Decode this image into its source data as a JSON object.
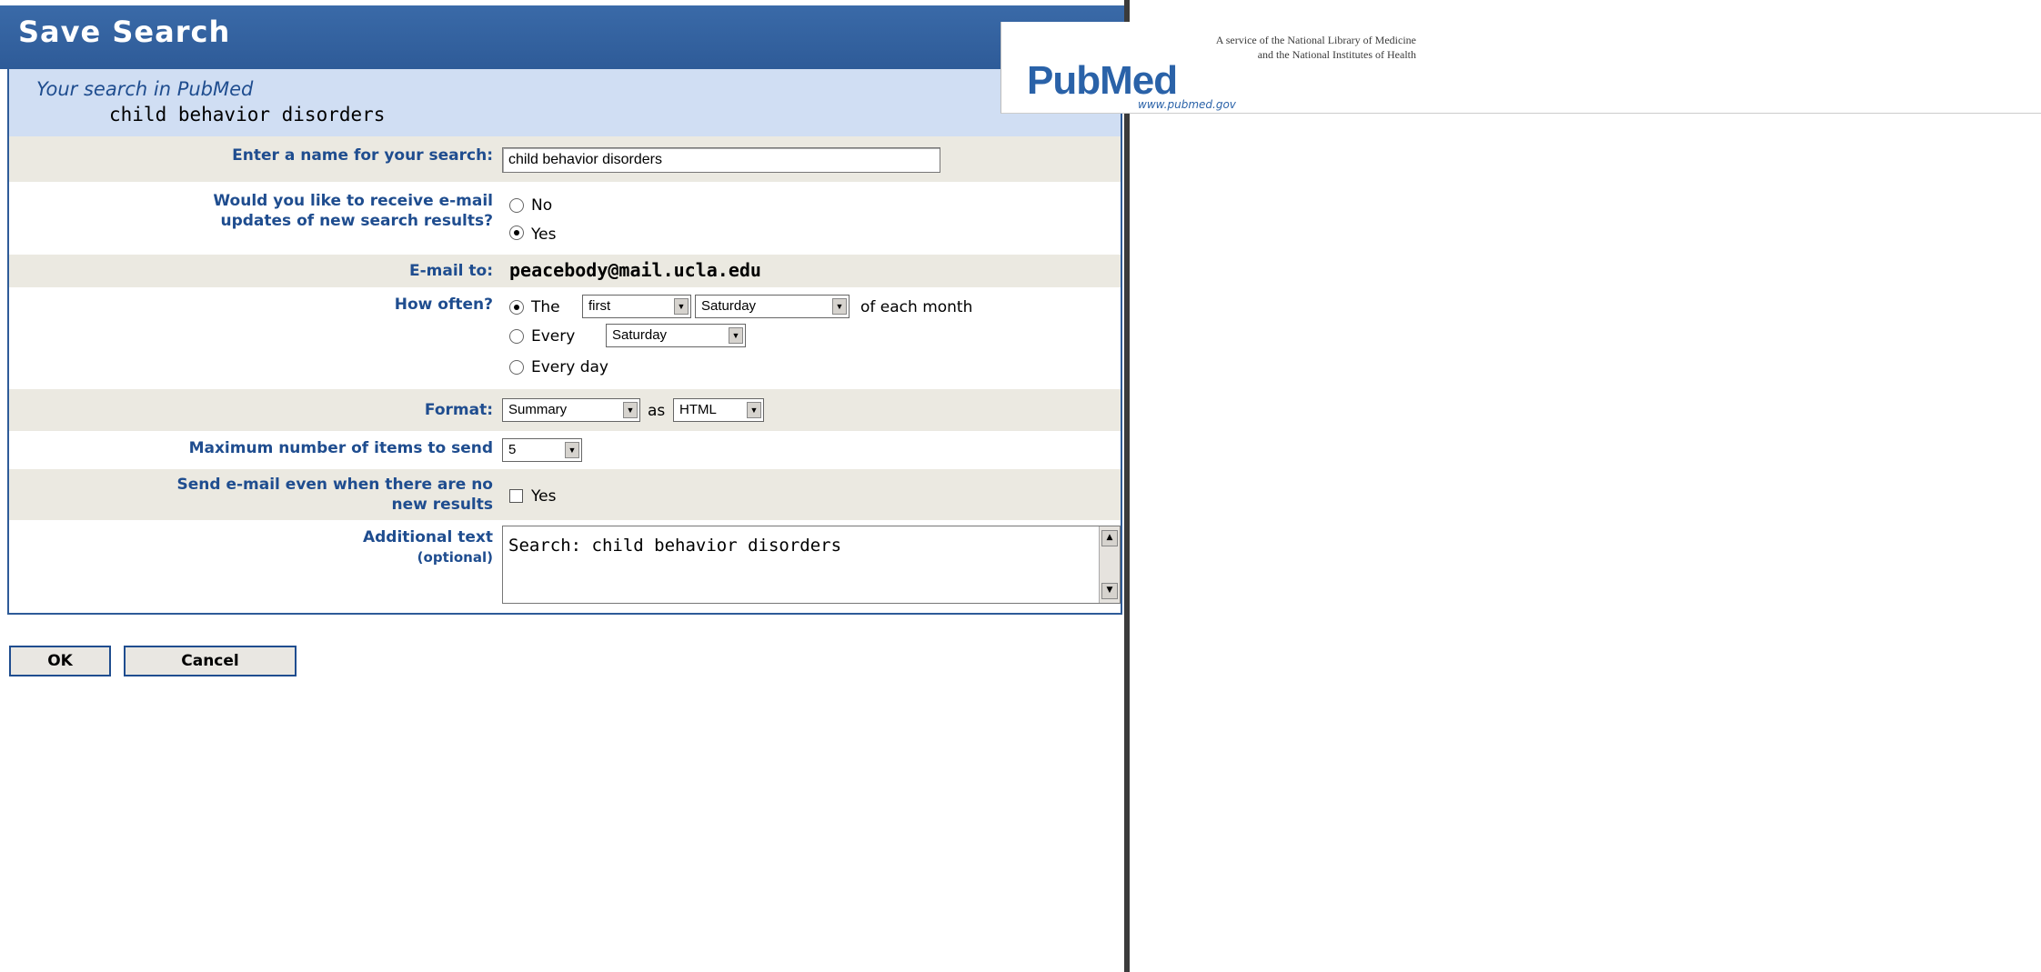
{
  "window": {
    "title": "Save Search"
  },
  "intro": {
    "label": "Your search in PubMed",
    "query": "child behavior disorders"
  },
  "name_row": {
    "label": "Enter a name for your search:",
    "value": "child behavior disorders"
  },
  "updates_row": {
    "label_line1": "Would you like to receive e-mail",
    "label_line2": "updates of new search results?",
    "options": [
      "No",
      "Yes"
    ],
    "selected": "Yes"
  },
  "email_row": {
    "label": "E-mail to:",
    "value": "peacebody@mail.ucla.edu"
  },
  "frequency_row": {
    "label": "How often?",
    "opt_the_label": "The",
    "ordinal_value": "first",
    "weekday_value": "Saturday",
    "suffix": "of each month",
    "opt_every_label": "Every",
    "every_weekday_value": "Saturday",
    "opt_daily_label": "Every day",
    "selected": "The"
  },
  "format_row": {
    "label": "Format:",
    "format_value": "Summary",
    "as_label": "as",
    "output_value": "HTML"
  },
  "max_row": {
    "label": "Maximum number of items to send",
    "value": "5"
  },
  "empty_row": {
    "label_line1": "Send e-mail even when there are no",
    "label_line2": "new results",
    "checkbox_label": "Yes",
    "checked": false
  },
  "additional_row": {
    "label_line1": "Additional text",
    "label_line2": "(optional)",
    "value": "Search: child behavior disorders"
  },
  "buttons": {
    "ok": "OK",
    "cancel": "Cancel"
  },
  "logo": {
    "brand_pub": "Pub",
    "brand_med": "Med",
    "url": "www.pubmed.gov",
    "service_line1": "A service of the National Library of Medicine",
    "service_line2": "and the National Institutes of Health"
  }
}
